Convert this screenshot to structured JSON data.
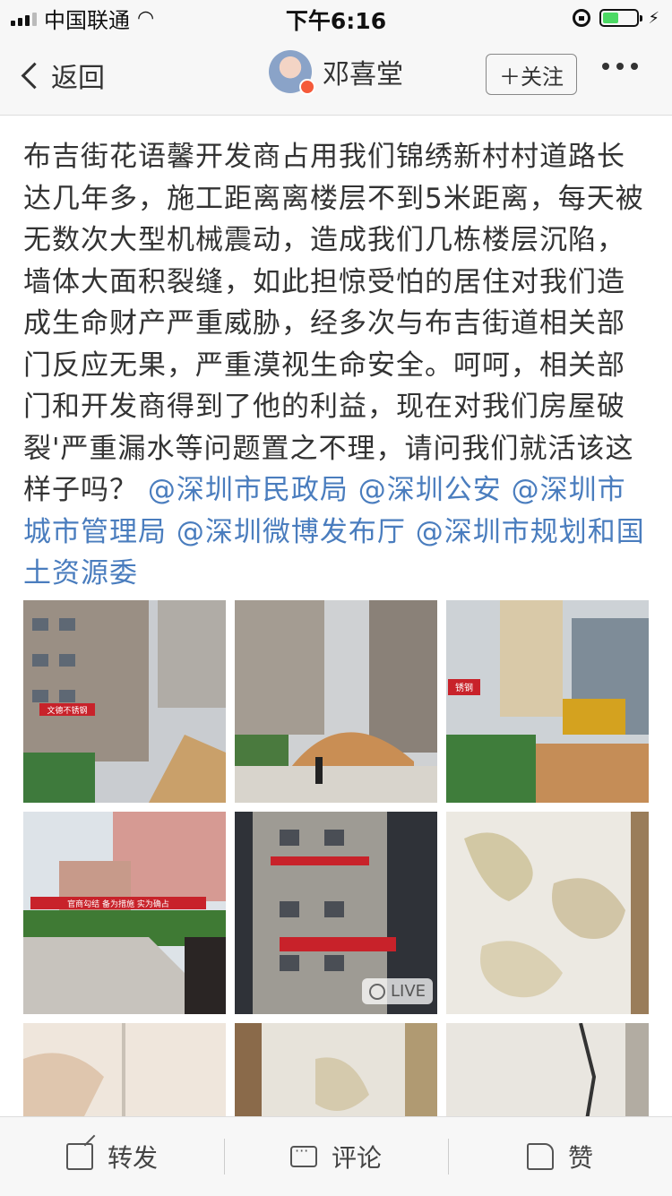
{
  "status_bar": {
    "carrier": "中国联通",
    "time": "下午6:16"
  },
  "nav": {
    "back_label": "返回",
    "username": "邓喜堂",
    "follow_label": "＋关注"
  },
  "post": {
    "text": "布吉街花语馨开发商占用我们锦绣新村村道路长达几年多，施工距离离楼层不到5米距离，每天被无数次大型机械震动，造成我们几栋楼层沉陷，墙体大面积裂缝，如此担惊受怕的居住对我们造成生命财产严重威胁，经多次与布吉街道相关部门反应无果，严重漠视生命安全。呵呵，相关部门和开发商得到了他的利益，现在对我们房屋破裂'严重漏水等问题置之不理，请问我们就活该这样子吗？",
    "mentions": [
      "@深圳市民政局",
      "@深圳公安",
      "@深圳市城市管理局",
      "@深圳微博发布厅",
      "@深圳市规划和国土资源委"
    ]
  },
  "photos": {
    "live_badge": "LIVE",
    "banner_texts": [
      "文德不锈钢",
      "锈钢",
      "官商勾结 备为措施 实为确占"
    ]
  },
  "toolbar": {
    "repost_label": "转发",
    "comment_label": "评论",
    "like_label": "赞"
  }
}
